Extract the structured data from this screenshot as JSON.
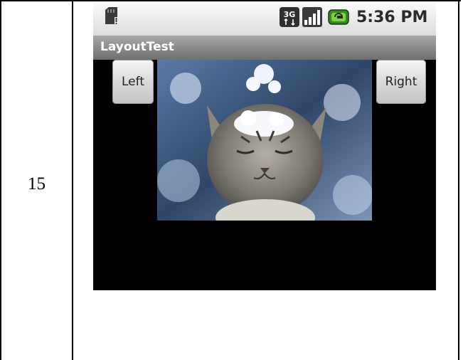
{
  "document": {
    "row_number": "15"
  },
  "status_bar": {
    "network_label": "3G",
    "time": "5:36 PM"
  },
  "app": {
    "title": "LayoutTest"
  },
  "buttons": {
    "left_label": "Left",
    "right_label": "Right"
  },
  "image": {
    "subject": "cat with snow on its head"
  },
  "icons": [
    "sd-card-icon",
    "network-3g-icon",
    "signal-bars-icon",
    "battery-icon"
  ],
  "colors": {
    "screen_background": "#000000",
    "status_bar": "#e6e6e6",
    "title_bar": "#8a8a8a",
    "button_face": "#d7d7d7"
  }
}
